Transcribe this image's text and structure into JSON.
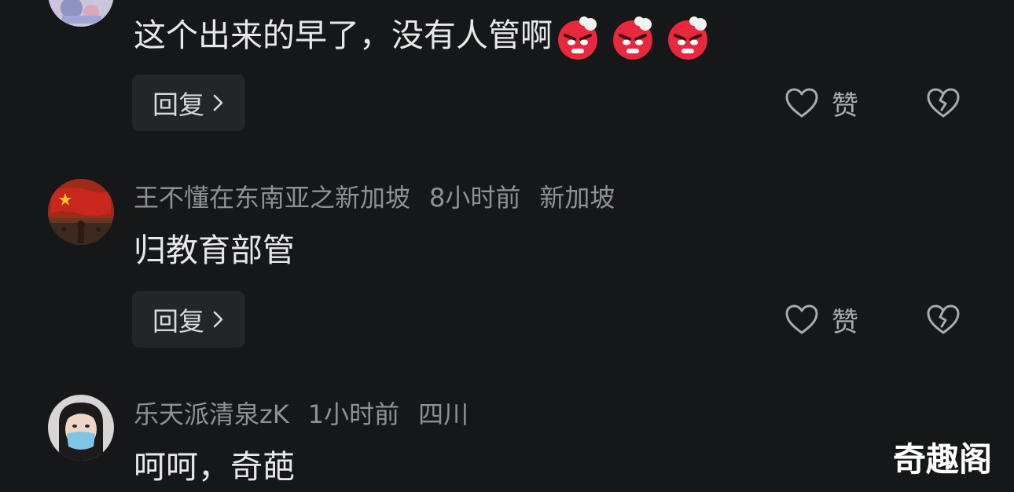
{
  "comments": [
    {
      "text": "这个出来的早了，没有人管啊",
      "emoji_names": [
        "angry-face-icon",
        "angry-face-icon",
        "angry-face-icon"
      ],
      "reply_label": "回复",
      "like_label": "赞"
    },
    {
      "username": "王不懂在东南亚之新加坡",
      "time": "8小时前",
      "location": "新加坡",
      "text": "归教育部管",
      "reply_label": "回复",
      "like_label": "赞"
    },
    {
      "username": "乐天派清泉zK",
      "time": "1小时前",
      "location": "四川",
      "text": "呵呵，奇葩"
    }
  ],
  "watermark": "奇趣阁",
  "colors": {
    "background": "#161719",
    "primary_text": "#e8e8ea",
    "secondary_text": "#8f9094",
    "button_bg": "#242528",
    "emoji_red": "#e8283c"
  }
}
